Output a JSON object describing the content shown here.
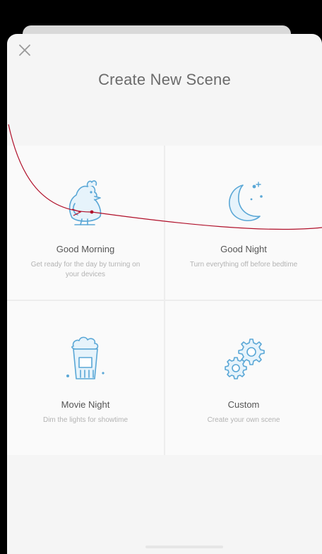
{
  "header": {
    "title": "Create New Scene",
    "close_icon": "close-icon"
  },
  "scenes": [
    {
      "title": "Good Morning",
      "description": "Get ready for the day by turning on your devices",
      "icon": "rooster-icon"
    },
    {
      "title": "Good Night",
      "description": "Turn everything off before bedtime",
      "icon": "moon-stars-icon"
    },
    {
      "title": "Movie Night",
      "description": "Dim the lights for showtime",
      "icon": "popcorn-icon"
    },
    {
      "title": "Custom",
      "description": "Create your own scene",
      "icon": "gears-icon"
    }
  ],
  "colors": {
    "icon_stroke": "#5aa7d6",
    "icon_fill": "#e6f3fb",
    "annotation": "#b0102a"
  }
}
